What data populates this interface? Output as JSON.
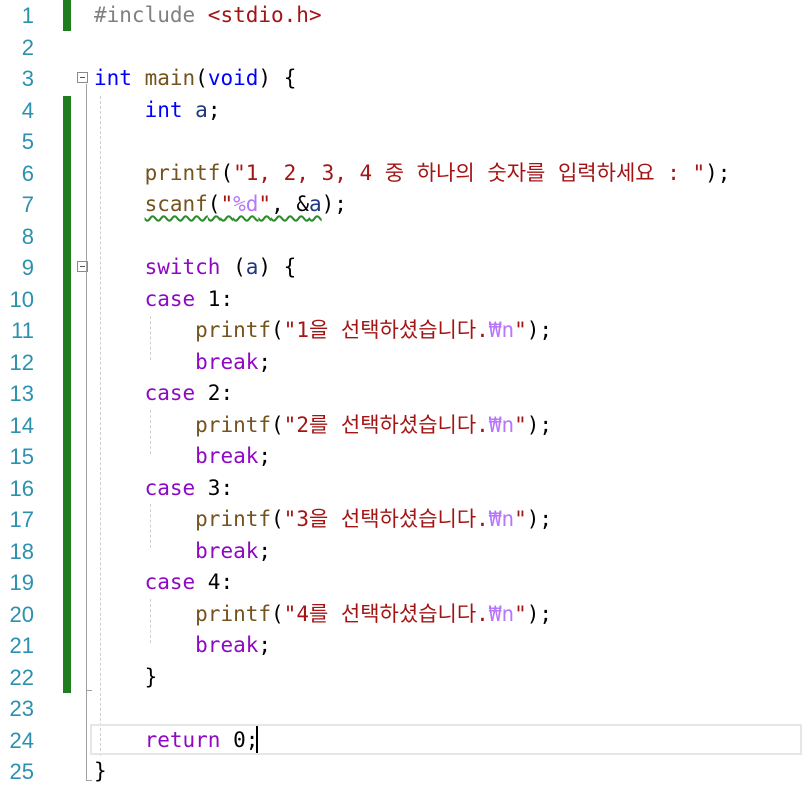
{
  "editor": {
    "colors": {
      "line_number": "#2b91af",
      "keyword": "#0000ff",
      "control_keyword": "#8f08c4",
      "function": "#74531f",
      "string": "#a31515",
      "preprocessor": "#808080",
      "escape": "#b776fb",
      "change_bar": "#1e7d1e"
    },
    "lines": [
      {
        "num": "1",
        "tokens": [
          {
            "t": "#include ",
            "c": "pp"
          },
          {
            "t": "<stdio.h>",
            "c": "inc"
          }
        ]
      },
      {
        "num": "2",
        "tokens": []
      },
      {
        "num": "3",
        "tokens": [
          {
            "t": "int",
            "c": "kw"
          },
          {
            "t": " ",
            "c": "plain"
          },
          {
            "t": "main",
            "c": "fn"
          },
          {
            "t": "(",
            "c": "plain"
          },
          {
            "t": "void",
            "c": "kw"
          },
          {
            "t": ") {",
            "c": "plain"
          }
        ]
      },
      {
        "num": "4",
        "tokens": [
          {
            "t": "    ",
            "c": "plain"
          },
          {
            "t": "int",
            "c": "kw"
          },
          {
            "t": " ",
            "c": "plain"
          },
          {
            "t": "a",
            "c": "var"
          },
          {
            "t": ";",
            "c": "plain"
          }
        ]
      },
      {
        "num": "5",
        "tokens": []
      },
      {
        "num": "6",
        "tokens": [
          {
            "t": "    ",
            "c": "plain"
          },
          {
            "t": "printf",
            "c": "fn"
          },
          {
            "t": "(",
            "c": "plain"
          },
          {
            "t": "\"1, 2, 3, 4 중 하나의 숫자를 입력하세요 : \"",
            "c": "str"
          },
          {
            "t": ");",
            "c": "plain"
          }
        ]
      },
      {
        "num": "7",
        "tokens": [
          {
            "t": "    ",
            "c": "plain"
          },
          {
            "t": "scanf",
            "c": "fn",
            "sq": true
          },
          {
            "t": "(",
            "c": "plain",
            "sq": true
          },
          {
            "t": "\"",
            "c": "str",
            "sq": true
          },
          {
            "t": "%d",
            "c": "esc",
            "sq": true
          },
          {
            "t": "\"",
            "c": "str",
            "sq": true
          },
          {
            "t": ", &",
            "c": "plain",
            "sq": true
          },
          {
            "t": "a",
            "c": "var",
            "sq": true
          },
          {
            "t": ");",
            "c": "plain"
          }
        ]
      },
      {
        "num": "8",
        "tokens": []
      },
      {
        "num": "9",
        "tokens": [
          {
            "t": "    ",
            "c": "plain"
          },
          {
            "t": "switch",
            "c": "ctrl"
          },
          {
            "t": " (",
            "c": "plain"
          },
          {
            "t": "a",
            "c": "var"
          },
          {
            "t": ") {",
            "c": "plain"
          }
        ]
      },
      {
        "num": "10",
        "tokens": [
          {
            "t": "    ",
            "c": "plain"
          },
          {
            "t": "case",
            "c": "ctrl"
          },
          {
            "t": " 1:",
            "c": "plain"
          }
        ]
      },
      {
        "num": "11",
        "tokens": [
          {
            "t": "        ",
            "c": "plain"
          },
          {
            "t": "printf",
            "c": "fn"
          },
          {
            "t": "(",
            "c": "plain"
          },
          {
            "t": "\"1을 선택하셨습니다.",
            "c": "str"
          },
          {
            "t": "₩n",
            "c": "esc"
          },
          {
            "t": "\"",
            "c": "str"
          },
          {
            "t": ");",
            "c": "plain"
          }
        ]
      },
      {
        "num": "12",
        "tokens": [
          {
            "t": "        ",
            "c": "plain"
          },
          {
            "t": "break",
            "c": "ctrl"
          },
          {
            "t": ";",
            "c": "plain"
          }
        ]
      },
      {
        "num": "13",
        "tokens": [
          {
            "t": "    ",
            "c": "plain"
          },
          {
            "t": "case",
            "c": "ctrl"
          },
          {
            "t": " 2:",
            "c": "plain"
          }
        ]
      },
      {
        "num": "14",
        "tokens": [
          {
            "t": "        ",
            "c": "plain"
          },
          {
            "t": "printf",
            "c": "fn"
          },
          {
            "t": "(",
            "c": "plain"
          },
          {
            "t": "\"2를 선택하셨습니다.",
            "c": "str"
          },
          {
            "t": "₩n",
            "c": "esc"
          },
          {
            "t": "\"",
            "c": "str"
          },
          {
            "t": ");",
            "c": "plain"
          }
        ]
      },
      {
        "num": "15",
        "tokens": [
          {
            "t": "        ",
            "c": "plain"
          },
          {
            "t": "break",
            "c": "ctrl"
          },
          {
            "t": ";",
            "c": "plain"
          }
        ]
      },
      {
        "num": "16",
        "tokens": [
          {
            "t": "    ",
            "c": "plain"
          },
          {
            "t": "case",
            "c": "ctrl"
          },
          {
            "t": " 3:",
            "c": "plain"
          }
        ]
      },
      {
        "num": "17",
        "tokens": [
          {
            "t": "        ",
            "c": "plain"
          },
          {
            "t": "printf",
            "c": "fn"
          },
          {
            "t": "(",
            "c": "plain"
          },
          {
            "t": "\"3을 선택하셨습니다.",
            "c": "str"
          },
          {
            "t": "₩n",
            "c": "esc"
          },
          {
            "t": "\"",
            "c": "str"
          },
          {
            "t": ");",
            "c": "plain"
          }
        ]
      },
      {
        "num": "18",
        "tokens": [
          {
            "t": "        ",
            "c": "plain"
          },
          {
            "t": "break",
            "c": "ctrl"
          },
          {
            "t": ";",
            "c": "plain"
          }
        ]
      },
      {
        "num": "19",
        "tokens": [
          {
            "t": "    ",
            "c": "plain"
          },
          {
            "t": "case",
            "c": "ctrl"
          },
          {
            "t": " 4:",
            "c": "plain"
          }
        ]
      },
      {
        "num": "20",
        "tokens": [
          {
            "t": "        ",
            "c": "plain"
          },
          {
            "t": "printf",
            "c": "fn"
          },
          {
            "t": "(",
            "c": "plain"
          },
          {
            "t": "\"4를 선택하셨습니다.",
            "c": "str"
          },
          {
            "t": "₩n",
            "c": "esc"
          },
          {
            "t": "\"",
            "c": "str"
          },
          {
            "t": ");",
            "c": "plain"
          }
        ]
      },
      {
        "num": "21",
        "tokens": [
          {
            "t": "        ",
            "c": "plain"
          },
          {
            "t": "break",
            "c": "ctrl"
          },
          {
            "t": ";",
            "c": "plain"
          }
        ]
      },
      {
        "num": "22",
        "tokens": [
          {
            "t": "    }",
            "c": "plain"
          }
        ]
      },
      {
        "num": "23",
        "tokens": []
      },
      {
        "num": "24",
        "tokens": [
          {
            "t": "    ",
            "c": "plain"
          },
          {
            "t": "return",
            "c": "ctrl"
          },
          {
            "t": " 0;",
            "c": "plain"
          }
        ]
      },
      {
        "num": "25",
        "tokens": [
          {
            "t": "}",
            "c": "plain"
          }
        ]
      }
    ]
  }
}
